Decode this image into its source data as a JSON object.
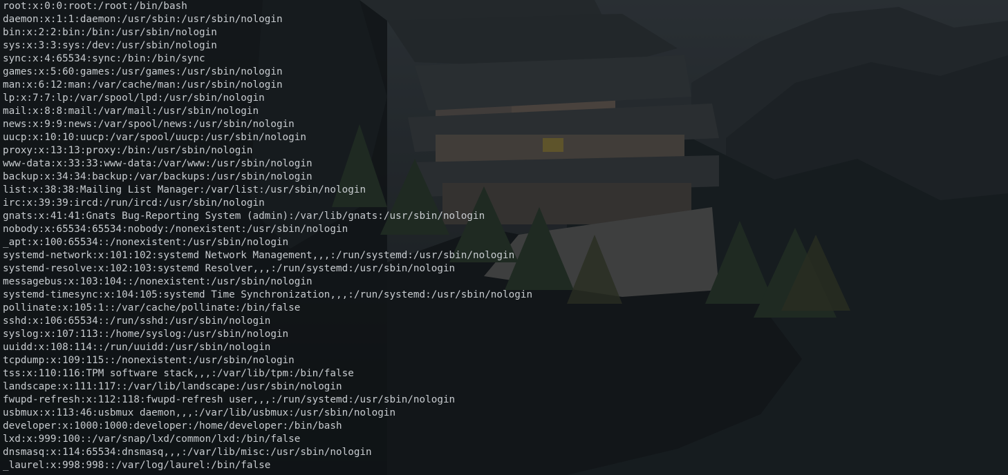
{
  "terminal": {
    "text_color": "#c8ccd0",
    "background_color": "#101417",
    "lines": [
      "root:x:0:0:root:/root:/bin/bash",
      "daemon:x:1:1:daemon:/usr/sbin:/usr/sbin/nologin",
      "bin:x:2:2:bin:/bin:/usr/sbin/nologin",
      "sys:x:3:3:sys:/dev:/usr/sbin/nologin",
      "sync:x:4:65534:sync:/bin:/bin/sync",
      "games:x:5:60:games:/usr/games:/usr/sbin/nologin",
      "man:x:6:12:man:/var/cache/man:/usr/sbin/nologin",
      "lp:x:7:7:lp:/var/spool/lpd:/usr/sbin/nologin",
      "mail:x:8:8:mail:/var/mail:/usr/sbin/nologin",
      "news:x:9:9:news:/var/spool/news:/usr/sbin/nologin",
      "uucp:x:10:10:uucp:/var/spool/uucp:/usr/sbin/nologin",
      "proxy:x:13:13:proxy:/bin:/usr/sbin/nologin",
      "www-data:x:33:33:www-data:/var/www:/usr/sbin/nologin",
      "backup:x:34:34:backup:/var/backups:/usr/sbin/nologin",
      "list:x:38:38:Mailing List Manager:/var/list:/usr/sbin/nologin",
      "irc:x:39:39:ircd:/run/ircd:/usr/sbin/nologin",
      "gnats:x:41:41:Gnats Bug-Reporting System (admin):/var/lib/gnats:/usr/sbin/nologin",
      "nobody:x:65534:65534:nobody:/nonexistent:/usr/sbin/nologin",
      "_apt:x:100:65534::/nonexistent:/usr/sbin/nologin",
      "systemd-network:x:101:102:systemd Network Management,,,:/run/systemd:/usr/sbin/nologin",
      "systemd-resolve:x:102:103:systemd Resolver,,,:/run/systemd:/usr/sbin/nologin",
      "messagebus:x:103:104::/nonexistent:/usr/sbin/nologin",
      "systemd-timesync:x:104:105:systemd Time Synchronization,,,:/run/systemd:/usr/sbin/nologin",
      "pollinate:x:105:1::/var/cache/pollinate:/bin/false",
      "sshd:x:106:65534::/run/sshd:/usr/sbin/nologin",
      "syslog:x:107:113::/home/syslog:/usr/sbin/nologin",
      "uuidd:x:108:114::/run/uuidd:/usr/sbin/nologin",
      "tcpdump:x:109:115::/nonexistent:/usr/sbin/nologin",
      "tss:x:110:116:TPM software stack,,,:/var/lib/tpm:/bin/false",
      "landscape:x:111:117::/var/lib/landscape:/usr/sbin/nologin",
      "fwupd-refresh:x:112:118:fwupd-refresh user,,,:/run/systemd:/usr/sbin/nologin",
      "usbmux:x:113:46:usbmux daemon,,,:/var/lib/usbmux:/usr/sbin/nologin",
      "developer:x:1000:1000:developer:/home/developer:/bin/bash",
      "lxd:x:999:100::/var/snap/lxd/common/lxd:/bin/false",
      "dnsmasq:x:114:65534:dnsmasq,,,:/var/lib/misc:/usr/sbin/nologin",
      "_laurel:x:998:998::/var/log/laurel:/bin/false"
    ]
  }
}
